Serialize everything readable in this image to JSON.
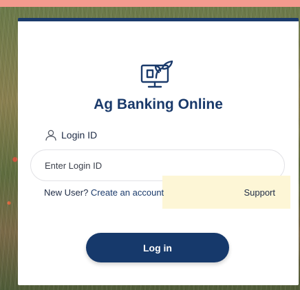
{
  "app": {
    "title": "Ag Banking Online"
  },
  "login": {
    "id_label": "Login ID",
    "id_placeholder": "Enter Login ID",
    "id_value": "",
    "new_user_label": "New User?",
    "create_account_link": "Create an account",
    "support_link": "Support",
    "submit_label": "Log in"
  },
  "icons": {
    "logo": "computer-plant-icon",
    "user": "user-icon"
  },
  "colors": {
    "brand_navy": "#1a3a6b",
    "button_bg": "#16396b",
    "support_highlight": "#fdf6d6",
    "top_band": "#f39a8e"
  }
}
